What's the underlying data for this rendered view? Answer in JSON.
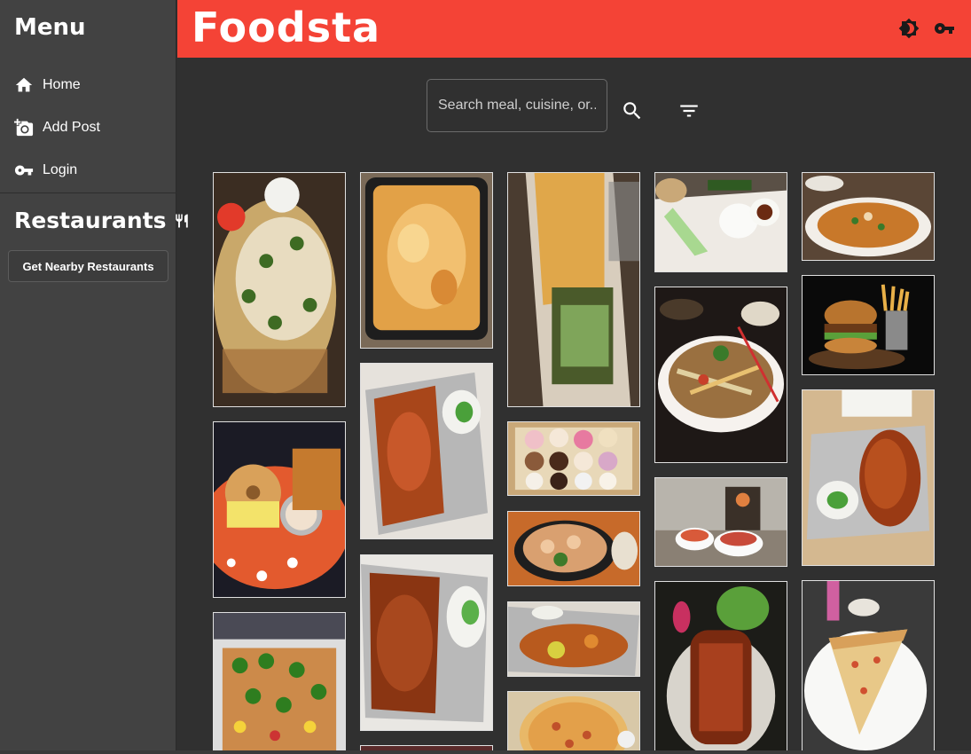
{
  "sidebar": {
    "title": "Menu",
    "items": [
      {
        "label": "Home",
        "icon": "home-icon"
      },
      {
        "label": "Add Post",
        "icon": "add-photo-icon"
      },
      {
        "label": "Login",
        "icon": "key-icon"
      }
    ],
    "restaurants_title": "Restaurants",
    "restaurants_icon": "fork-knife-icon",
    "nearby_button": "Get Nearby Restaurants"
  },
  "header": {
    "brand": "Foodsta",
    "background": "#f44336",
    "icons": [
      "brightness-icon",
      "key-icon"
    ]
  },
  "search": {
    "placeholder": "Search meal, cuisine, or...",
    "search_icon": "search-icon",
    "filter_icon": "filter-icon"
  },
  "posts": [
    {
      "name": "nachos",
      "icon": "food-photo"
    },
    {
      "name": "mac-and-cheese",
      "icon": "food-photo"
    },
    {
      "name": "fries-sandwich",
      "icon": "food-photo"
    },
    {
      "name": "bao-platter",
      "icon": "food-photo"
    },
    {
      "name": "poutine",
      "icon": "food-photo"
    },
    {
      "name": "bagel-breakfast",
      "icon": "food-photo"
    },
    {
      "name": "foil-curry",
      "icon": "food-photo"
    },
    {
      "name": "donut-box",
      "icon": "food-photo"
    },
    {
      "name": "pho-bowl",
      "icon": "food-photo"
    },
    {
      "name": "burger-fries",
      "icon": "food-photo"
    },
    {
      "name": "jalapeno-nachos",
      "icon": "food-photo"
    },
    {
      "name": "foil-rice-curry",
      "icon": "food-photo"
    },
    {
      "name": "shrimp-bowl",
      "icon": "food-photo"
    },
    {
      "name": "candle-bowls",
      "icon": "food-photo"
    },
    {
      "name": "foil-rice-curry-2",
      "icon": "food-photo"
    },
    {
      "name": "foil-tray",
      "icon": "food-photo"
    },
    {
      "name": "glazed-fish",
      "icon": "food-photo"
    },
    {
      "name": "pizza-slice",
      "icon": "food-photo"
    },
    {
      "name": "pizza-whole",
      "icon": "food-photo"
    }
  ]
}
